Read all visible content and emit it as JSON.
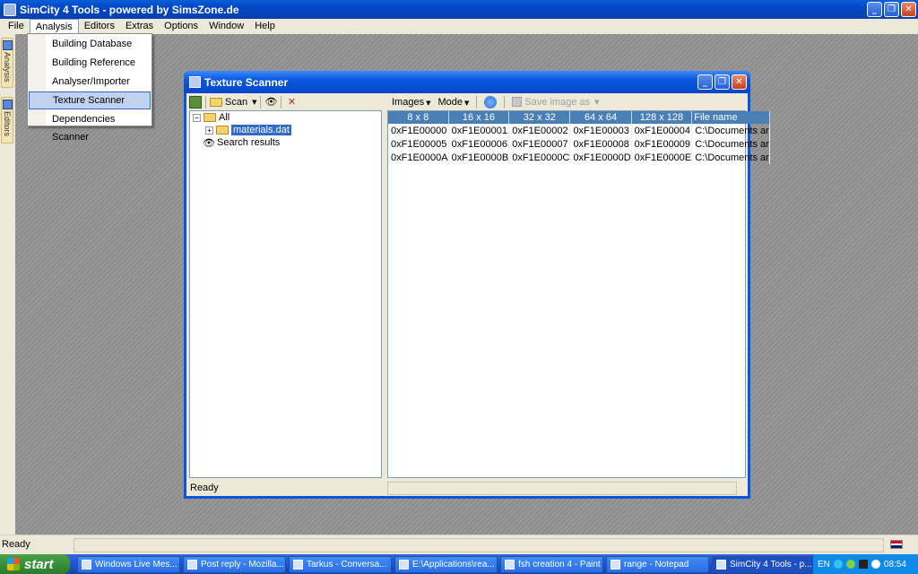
{
  "app": {
    "title": "SimCity 4 Tools - powered by SimsZone.de",
    "minimize": "_",
    "restore": "❐",
    "close": "✕"
  },
  "menubar": [
    "File",
    "Analysis",
    "Editors",
    "Extras",
    "Options",
    "Window",
    "Help"
  ],
  "dock_tabs": [
    "Analysis",
    "Editors"
  ],
  "dropdown": [
    "Building Database",
    "Building Reference",
    "Analyser/Importer",
    "Texture Scanner",
    "Dependencies Scanner"
  ],
  "window": {
    "title": "Texture Scanner",
    "left_toolbar": {
      "scan_label": "Scan"
    },
    "right_toolbar": {
      "images_label": "Images",
      "mode_label": "Mode",
      "save_label": "Save image as"
    },
    "tree": {
      "root": "All",
      "child": "materials.dat",
      "search": "Search results"
    },
    "grid": {
      "columns": [
        "8 x 8",
        "16 x 16",
        "32 x 32",
        "64 x 64",
        "128 x 128",
        "File name"
      ],
      "rows": [
        [
          "0xF1E00000",
          "0xF1E00001",
          "0xF1E00002",
          "0xF1E00003",
          "0xF1E00004",
          "C:\\Documents ar"
        ],
        [
          "0xF1E00005",
          "0xF1E00006",
          "0xF1E00007",
          "0xF1E00008",
          "0xF1E00009",
          "C:\\Documents ar"
        ],
        [
          "0xF1E0000A",
          "0xF1E0000B",
          "0xF1E0000C",
          "0xF1E0000D",
          "0xF1E0000E",
          "C:\\Documents ar"
        ]
      ]
    },
    "status": "Ready"
  },
  "statusbar": {
    "text": "Ready"
  },
  "taskbar": {
    "start": "start",
    "tasks": [
      "Windows Live Mes...",
      "Post reply - Mozilla...",
      "Tarkus - Conversa...",
      "E:\\Applications\\rea...",
      "fsh creation 4 - Paint",
      "range - Notepad",
      "SimCity 4 Tools - p..."
    ],
    "lang": "EN",
    "clock": "08:54"
  }
}
